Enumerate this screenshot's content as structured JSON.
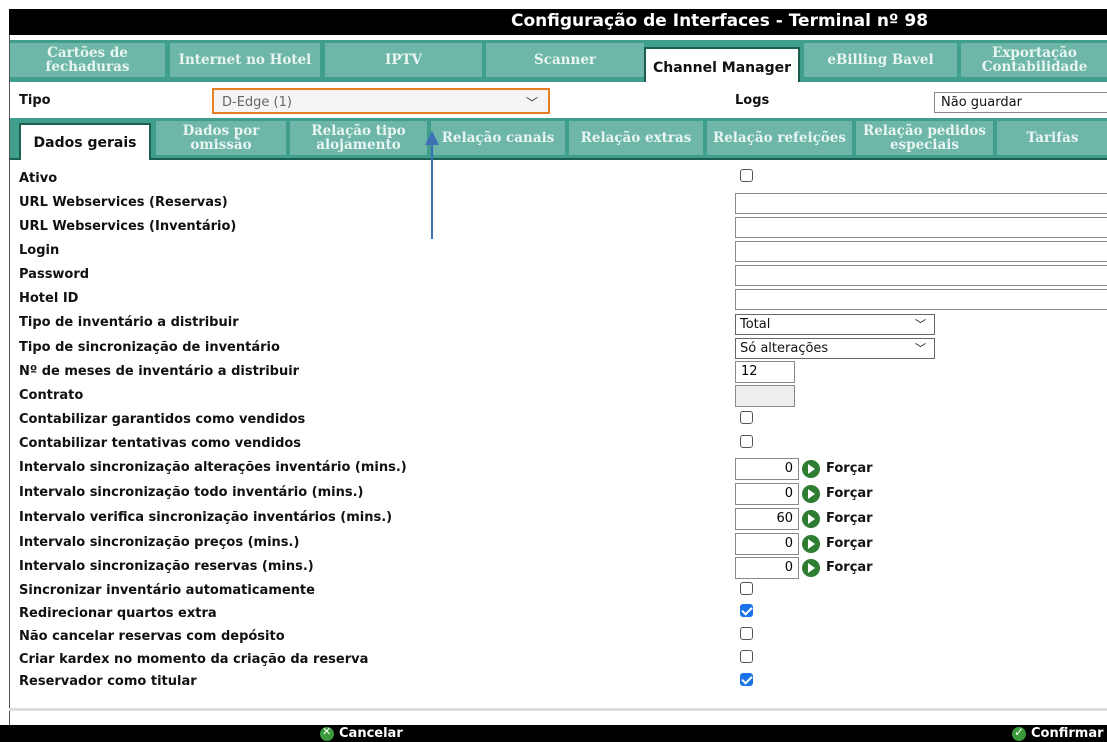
{
  "window": {
    "title": "Configuração de Interfaces - Terminal nº 98"
  },
  "top_tabs": [
    {
      "label": "Cartões de fechaduras"
    },
    {
      "label": "Internet no Hotel"
    },
    {
      "label": "IPTV"
    },
    {
      "label": "Scanner"
    },
    {
      "label": "Channel Manager",
      "active": true
    },
    {
      "label": "eBilling Bavel"
    },
    {
      "label": "Exportação Contabilidade"
    }
  ],
  "tipo": {
    "label": "Tipo",
    "value": "D-Edge (1)"
  },
  "logs": {
    "label": "Logs",
    "value": "Não guardar"
  },
  "sub_tabs": [
    {
      "label": "Dados gerais",
      "active": true
    },
    {
      "label": "Dados por omissão"
    },
    {
      "label": "Relação tipo alojamento"
    },
    {
      "label": "Relação canais"
    },
    {
      "label": "Relação extras"
    },
    {
      "label": "Relação refeições"
    },
    {
      "label": "Relação pedidos especiais"
    },
    {
      "label": "Tarifas"
    }
  ],
  "form": {
    "ativo": {
      "label": "Ativo",
      "checked": false
    },
    "url_reservas": {
      "label": "URL Webservices (Reservas)",
      "value": ""
    },
    "url_inventario": {
      "label": "URL Webservices (Inventário)",
      "value": ""
    },
    "login": {
      "label": "Login",
      "value": ""
    },
    "password": {
      "label": "Password",
      "value": ""
    },
    "hotel_id": {
      "label": "Hotel ID",
      "value": ""
    },
    "tipo_inventario": {
      "label": "Tipo de inventário a distribuir",
      "value": "Total"
    },
    "tipo_sync": {
      "label": "Tipo de sincronização de inventário",
      "value": "Só alterações"
    },
    "meses": {
      "label": "Nº de meses de inventário a distribuir",
      "value": "12"
    },
    "contrato": {
      "label": "Contrato",
      "value": ""
    },
    "garantidos": {
      "label": "Contabilizar garantidos como vendidos",
      "checked": false
    },
    "tentativas": {
      "label": "Contabilizar tentativas como vendidos",
      "checked": false
    },
    "int_alteracoes": {
      "label": "Intervalo sincronização alterações inventário (mins.)",
      "value": "0"
    },
    "int_todo": {
      "label": "Intervalo sincronização todo inventário (mins.)",
      "value": "0"
    },
    "int_verifica": {
      "label": "Intervalo verifica sincronização inventários (mins.)",
      "value": "60"
    },
    "int_precos": {
      "label": "Intervalo sincronização preços (mins.)",
      "value": "0"
    },
    "int_reservas": {
      "label": "Intervalo sincronização reservas (mins.)",
      "value": "0"
    },
    "force_label": "Forçar",
    "sync_auto": {
      "label": "Sincronizar inventário automaticamente",
      "checked": false
    },
    "redirecionar": {
      "label": "Redirecionar quartos extra",
      "checked": true
    },
    "nao_cancelar": {
      "label": "Não cancelar reservas com depósito",
      "checked": false
    },
    "kardex": {
      "label": "Criar kardex no momento da criação da reserva",
      "checked": false
    },
    "titular": {
      "label": "Reservador como titular",
      "checked": true
    }
  },
  "footer": {
    "cancel_label": "Cancelar",
    "confirm_label": "Confirmar"
  },
  "colors": {
    "tab_bg": "#3f9e8c",
    "tab_item": "#6db6a8",
    "highlight": "#e67e22",
    "annotation_arrow": "#3b6fb6"
  }
}
